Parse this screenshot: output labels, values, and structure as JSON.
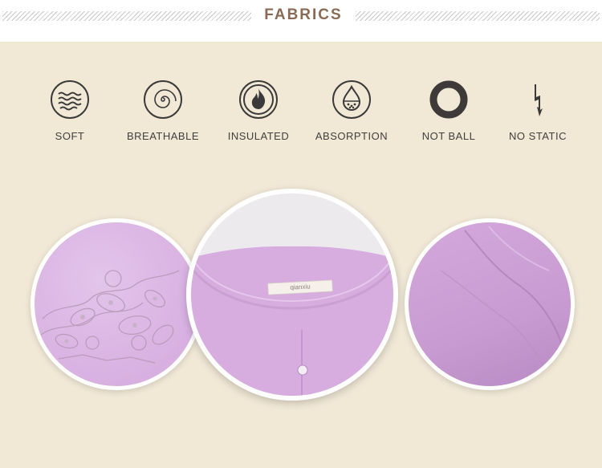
{
  "header": {
    "title": "FABRICS"
  },
  "features": [
    {
      "label": "SOFT",
      "icon": "waves-icon"
    },
    {
      "label": "BREATHABLE",
      "icon": "spiral-icon"
    },
    {
      "label": "INSULATED",
      "icon": "flame-icon"
    },
    {
      "label": "ABSORPTION",
      "icon": "droplet-icon"
    },
    {
      "label": "NOT BALL",
      "icon": "ring-icon"
    },
    {
      "label": "NO STATIC",
      "icon": "lightning-icon"
    }
  ],
  "photos": {
    "center_label_text": "qianxiu",
    "left": "embroidered-fabric-photo",
    "center": "collar-neckline-photo",
    "right": "sleeve-cuff-photo"
  },
  "colors": {
    "background": "#f1e8d6",
    "title": "#8a6a55",
    "garment": "#d9b2e0"
  }
}
